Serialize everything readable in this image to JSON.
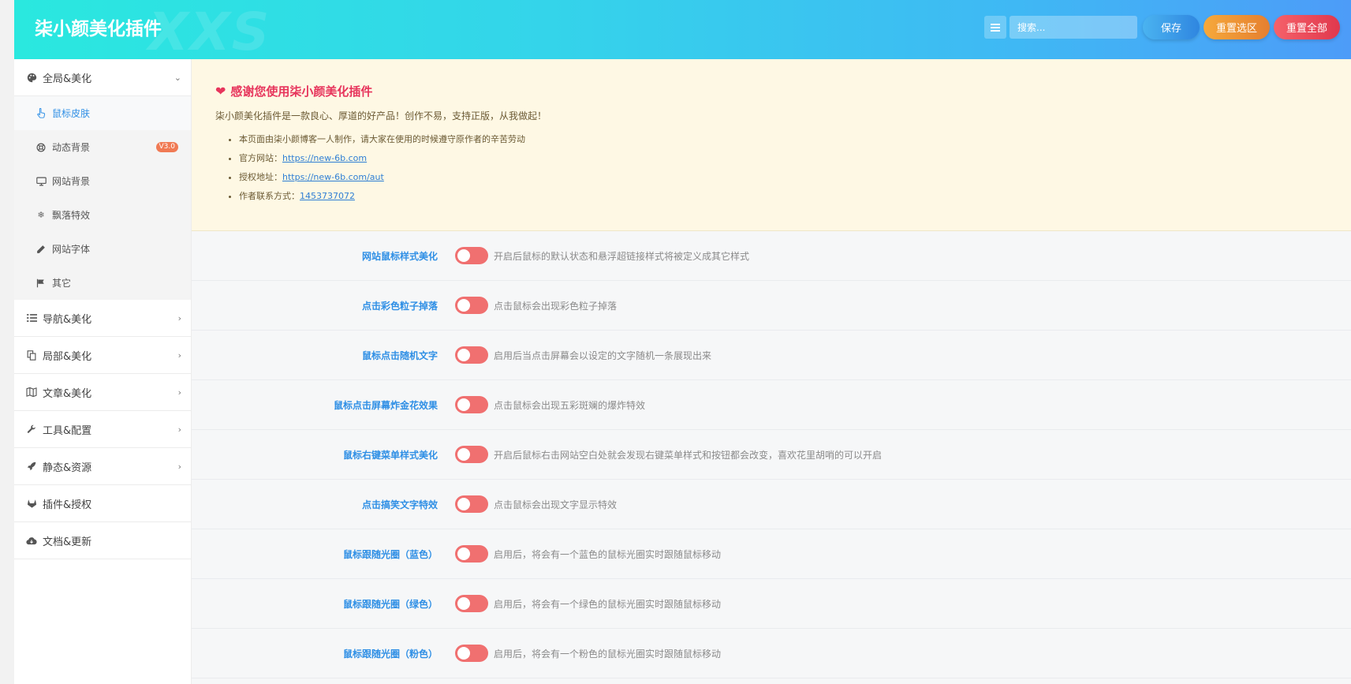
{
  "header": {
    "brand": "柒小颜美化插件",
    "watermark": "XXS",
    "search_placeholder": "搜索...",
    "save_label": "保存",
    "reset_section_label": "重置选区",
    "reset_all_label": "重置全部"
  },
  "sidebar": {
    "groups": [
      {
        "label": "全局&美化",
        "icon": "palette-icon",
        "expanded": true,
        "items": [
          {
            "label": "鼠标皮肤",
            "icon": "pointer-hand-icon",
            "active": true
          },
          {
            "label": "动态背景",
            "icon": "lifebuoy-icon",
            "badge": "V3.0"
          },
          {
            "label": "网站背景",
            "icon": "monitor-icon"
          },
          {
            "label": "飘落特效",
            "icon": "snowflake-icon"
          },
          {
            "label": "网站字体",
            "icon": "pencil-icon"
          },
          {
            "label": "其它",
            "icon": "flag-icon"
          }
        ]
      },
      {
        "label": "导航&美化",
        "icon": "list-icon"
      },
      {
        "label": "局部&美化",
        "icon": "copy-icon"
      },
      {
        "label": "文章&美化",
        "icon": "map-icon"
      },
      {
        "label": "工具&配置",
        "icon": "wrench-icon"
      },
      {
        "label": "静态&资源",
        "icon": "rocket-icon"
      },
      {
        "label": "插件&授权",
        "icon": "gitlab-icon"
      },
      {
        "label": "文档&更新",
        "icon": "cloud-download-icon"
      }
    ]
  },
  "notice": {
    "title": "感谢您使用柒小颜美化插件",
    "description": "柒小颜美化插件是一款良心、厚道的好产品！创作不易，支持正版，从我做起！",
    "items": [
      {
        "text": "本页面由柒小颜博客一人制作，请大家在使用的时候遵守原作者的辛苦劳动",
        "link": ""
      },
      {
        "text": "官方网站：",
        "link": "https://new-6b.com"
      },
      {
        "text": "授权地址：",
        "link": "https://new-6b.com/aut"
      },
      {
        "text": "作者联系方式：",
        "link": "1453737072"
      }
    ]
  },
  "settings": [
    {
      "label": "网站鼠标样式美化",
      "description": "开启后鼠标的默认状态和悬浮超链接样式将被定义成其它样式",
      "enabled": false
    },
    {
      "label": "点击彩色粒子掉落",
      "description": "点击鼠标会出现彩色粒子掉落",
      "enabled": false
    },
    {
      "label": "鼠标点击随机文字",
      "description": "启用后当点击屏幕会以设定的文字随机一条展现出来",
      "enabled": false
    },
    {
      "label": "鼠标点击屏幕炸金花效果",
      "description": "点击鼠标会出现五彩斑斓的爆炸特效",
      "enabled": false
    },
    {
      "label": "鼠标右键菜单样式美化",
      "description": "开启后鼠标右击网站空白处就会发现右键菜单样式和按钮都会改变，喜欢花里胡哨的可以开启",
      "enabled": false
    },
    {
      "label": "点击搞笑文字特效",
      "description": "点击鼠标会出现文字显示特效",
      "enabled": false
    },
    {
      "label": "鼠标跟随光圈（蓝色）",
      "description": "启用后，将会有一个蓝色的鼠标光圈实时跟随鼠标移动",
      "enabled": false
    },
    {
      "label": "鼠标跟随光圈（绿色）",
      "description": "启用后，将会有一个绿色的鼠标光圈实时跟随鼠标移动",
      "enabled": false
    },
    {
      "label": "鼠标跟随光圈（粉色）",
      "description": "启用后，将会有一个粉色的鼠标光圈实时跟随鼠标移动",
      "enabled": false
    }
  ],
  "colors": {
    "accent": "#2f8fe5",
    "toggle_off": "#f07070",
    "notice_bg": "#fef8e4",
    "notice_title": "#e7355c"
  }
}
